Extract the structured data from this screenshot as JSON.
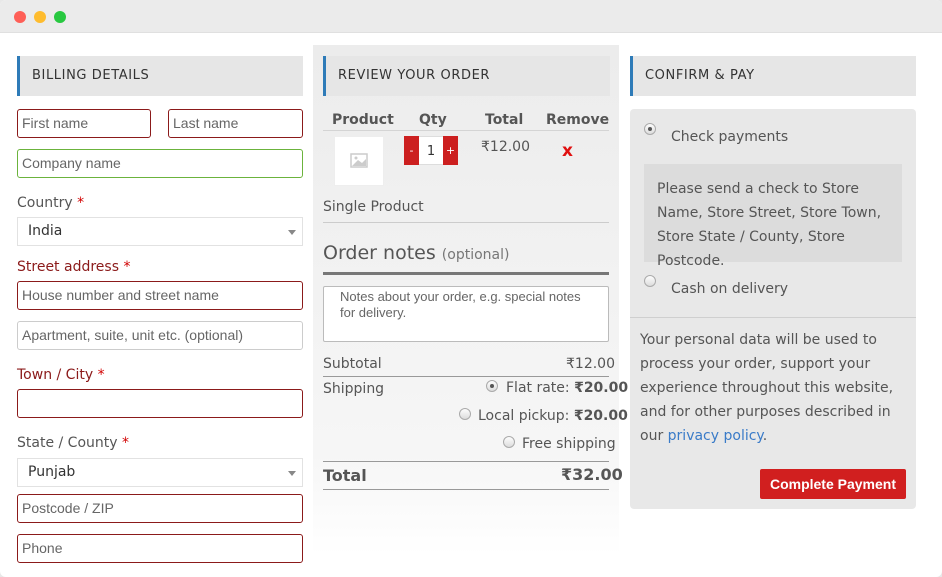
{
  "billing": {
    "heading": "BILLING DETAILS",
    "first_name_placeholder": "First name",
    "last_name_placeholder": "Last name",
    "company_placeholder": "Company name",
    "country_label": "Country",
    "country_value": "India",
    "street_label": "Street address",
    "street_placeholder": "House number and street name",
    "apartment_placeholder": "Apartment, suite, unit etc. (optional)",
    "city_label": "Town / City",
    "state_label": "State / County",
    "state_value": "Punjab",
    "postcode_placeholder": "Postcode / ZIP",
    "phone_placeholder": "Phone",
    "required_mark": "*"
  },
  "review": {
    "heading": "REVIEW YOUR ORDER",
    "columns": [
      "Product",
      "Qty",
      "Total",
      "Remove"
    ],
    "item": {
      "qty": "1",
      "minus": "-",
      "plus": "+",
      "total": "₹12.00",
      "remove": "x",
      "name": "Single Product"
    },
    "notes_title": "Order notes",
    "notes_optional": "(optional)",
    "notes_placeholder": "Notes about your order, e.g. special notes for delivery.",
    "subtotal_label": "Subtotal",
    "subtotal_value": "₹12.00",
    "shipping_label": "Shipping",
    "shipping_options": [
      {
        "label": "Flat rate:",
        "price": "₹20.00",
        "selected": true
      },
      {
        "label": "Local pickup:",
        "price": "₹20.00",
        "selected": false
      },
      {
        "label": "Free shipping",
        "price": "",
        "selected": false
      }
    ],
    "total_label": "Total",
    "total_value": "₹32.00"
  },
  "confirm": {
    "heading": "CONFIRM & PAY",
    "check_label": "Check payments",
    "check_notice": "Please send a check to Store Name, Store Street, Store Town, Store State / County, Store Postcode.",
    "cod_label": "Cash on delivery",
    "privacy_text": "Your personal data will be used to process your order, support your experience throughout this website, and for other purposes described in our",
    "privacy_link": "privacy policy",
    "privacy_end": ".",
    "pay_button": "Complete Payment"
  },
  "colors": {
    "accent_blue": "#2e7bb8",
    "error_red": "#8b1a1a",
    "valid_green": "#6bb33c",
    "button_red": "#d11f1f"
  }
}
